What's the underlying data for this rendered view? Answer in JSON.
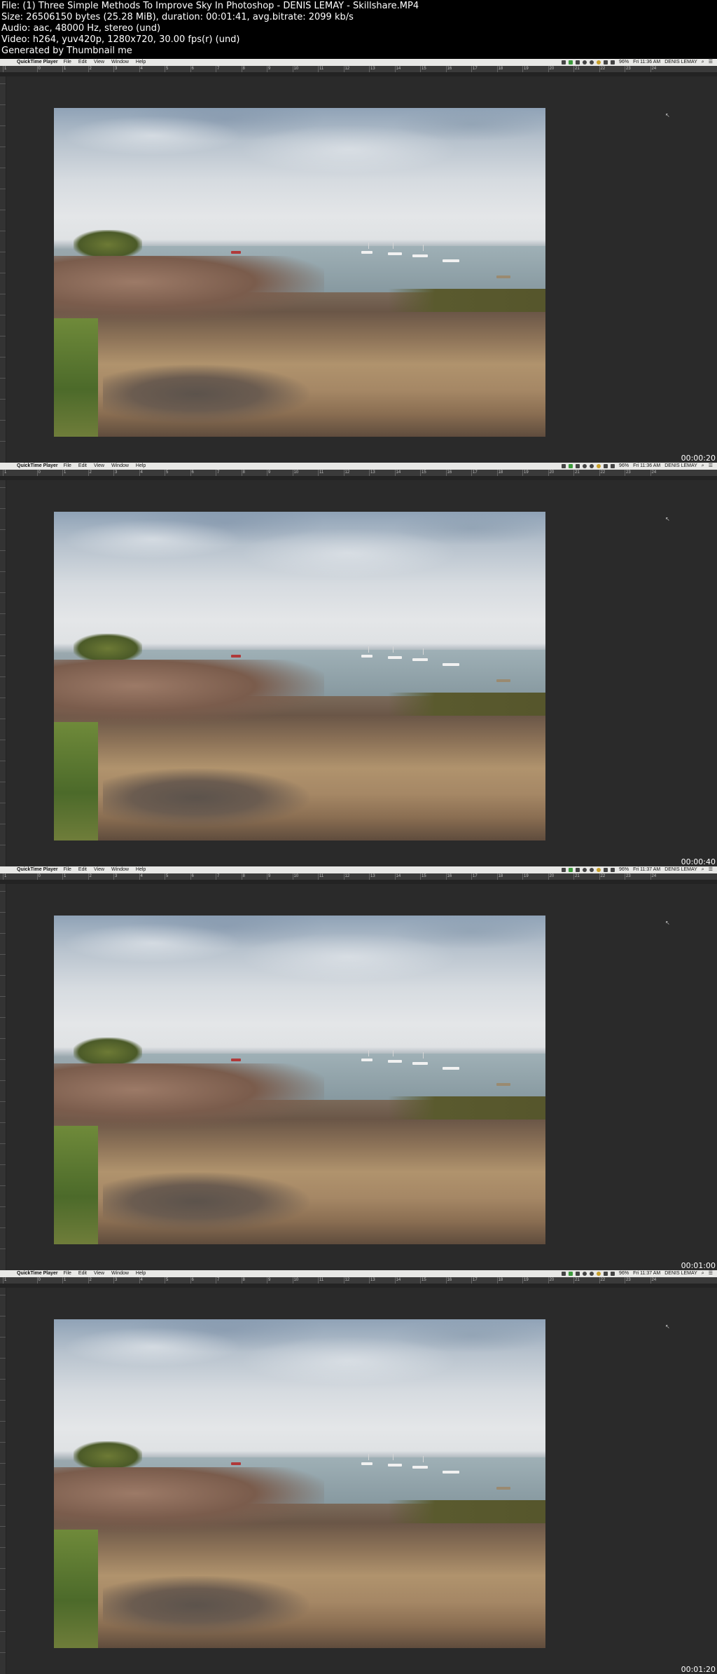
{
  "header": {
    "lines": [
      "File: (1) Three Simple Methods To Improve Sky In Photoshop - DENIS LEMAY - Skillshare.MP4",
      "Size: 26506150 bytes (25.28 MiB), duration: 00:01:41, avg.bitrate: 2099 kb/s",
      "Audio: aac, 48000 Hz, stereo (und)",
      "Video: h264, yuv420p, 1280x720, 30.00 fps(r) (und)",
      "Generated by Thumbnail me"
    ]
  },
  "menubar": {
    "apple_glyph": "",
    "app_name": "QuickTime Player",
    "menu": [
      "File",
      "Edit",
      "View",
      "Window",
      "Help"
    ],
    "battery": "96%",
    "user": "DENIS LEMAY",
    "tray_icons": [
      "wifi-icon",
      "green-app-icon",
      "shield-icon",
      "sync-icon",
      "cloud-icon",
      "gauge-icon",
      "bluetooth-icon",
      "volume-icon"
    ]
  },
  "ruler": {
    "labels": [
      "1",
      "0",
      "1",
      "2",
      "3",
      "4",
      "5",
      "6",
      "7",
      "8",
      "9",
      "10",
      "11",
      "12",
      "13",
      "14",
      "15",
      "16",
      "17",
      "18",
      "19",
      "20",
      "21",
      "22",
      "23",
      "24"
    ]
  },
  "frames": [
    {
      "clock": "Fri 11:36 AM",
      "timestamp": "00:00:20"
    },
    {
      "clock": "Fri 11:36 AM",
      "timestamp": "00:00:40"
    },
    {
      "clock": "Fri 11:37 AM",
      "timestamp": "00:01:00"
    },
    {
      "clock": "Fri 11:37 AM",
      "timestamp": "00:01:20"
    }
  ],
  "colors": {
    "canvas_bg": "#2a2a2a",
    "menubar_bg": "#e8e8e6",
    "page_bg": "#000000"
  }
}
